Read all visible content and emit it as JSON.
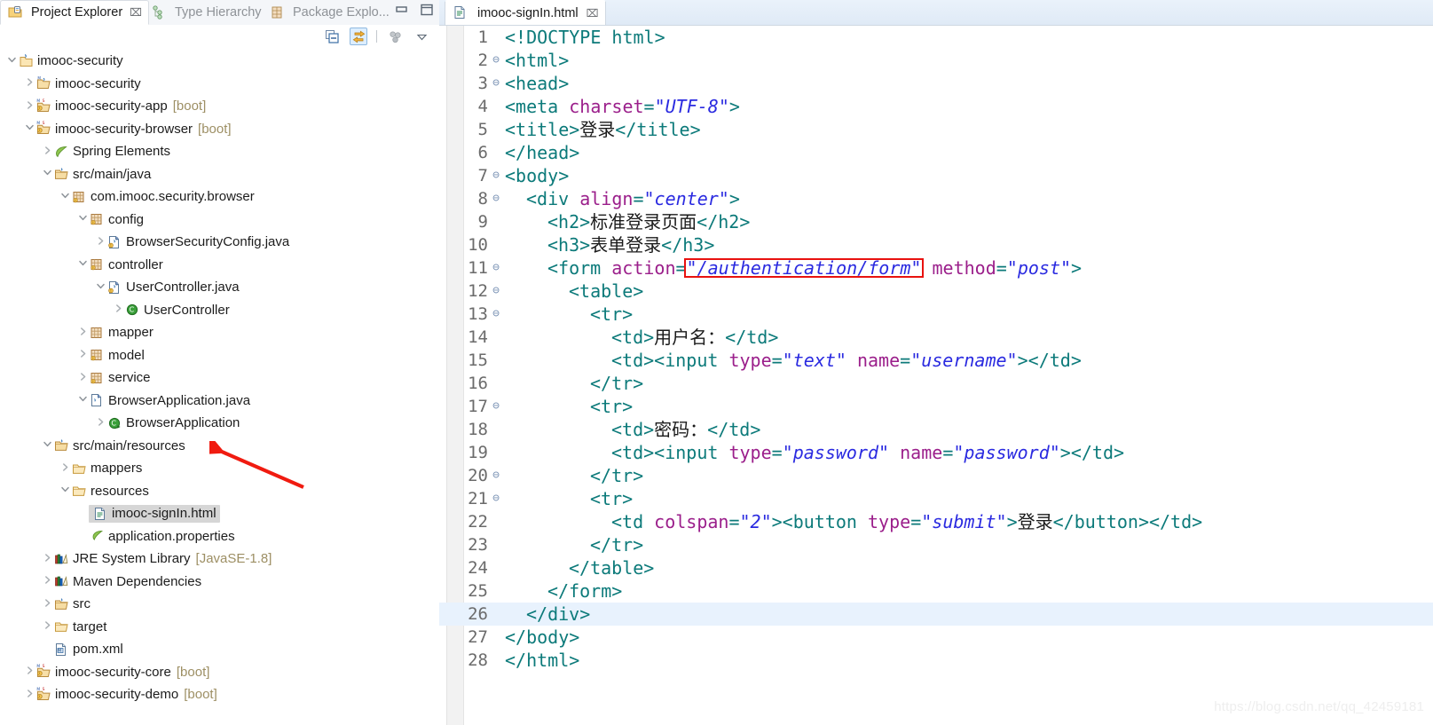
{
  "window": {
    "minimize_icon": "minimize-icon",
    "maximize_icon": "maximize-icon"
  },
  "left_view": {
    "tabs": [
      {
        "label": "Project Explorer",
        "icon": "project-explorer-icon",
        "active": true,
        "close": "⌧"
      },
      {
        "label": "Type Hierarchy",
        "icon": "type-hierarchy-icon",
        "active": false
      },
      {
        "label": "Package Explo...",
        "icon": "package-explorer-icon",
        "active": false
      }
    ],
    "toolbar": [
      {
        "name": "collapse-all-button",
        "title": "Collapse All"
      },
      {
        "name": "link-with-editor-button",
        "title": "Link with Editor",
        "toggled": true
      },
      {
        "name": "view-menu-dots-button",
        "title": "View Menu"
      },
      {
        "name": "view-menu-chevron-button",
        "title": "View Menu"
      }
    ],
    "tree": [
      {
        "indent": 0,
        "twist": "v",
        "icon": "java-project-icon",
        "label": "imooc-security",
        "suffix": ""
      },
      {
        "indent": 1,
        "twist": ">",
        "icon": "maven-module-icon",
        "label": "imooc-security",
        "suffix": ""
      },
      {
        "indent": 1,
        "twist": ">",
        "icon": "maven-boot-module-icon",
        "label": "imooc-security-app",
        "suffix": "[boot]"
      },
      {
        "indent": 1,
        "twist": "v",
        "icon": "maven-boot-module-icon",
        "label": "imooc-security-browser",
        "suffix": "[boot]"
      },
      {
        "indent": 2,
        "twist": ">",
        "icon": "spring-leaf-icon",
        "label": "Spring Elements",
        "suffix": ""
      },
      {
        "indent": 2,
        "twist": "v",
        "icon": "source-folder-icon",
        "label": "src/main/java",
        "suffix": ""
      },
      {
        "indent": 3,
        "twist": "v",
        "icon": "package-icon",
        "label": "com.imooc.security.browser",
        "suffix": ""
      },
      {
        "indent": 4,
        "twist": "v",
        "icon": "package-icon",
        "label": "config",
        "suffix": ""
      },
      {
        "indent": 5,
        "twist": ">",
        "icon": "java-file-icon",
        "label": "BrowserSecurityConfig.java",
        "suffix": ""
      },
      {
        "indent": 4,
        "twist": "v",
        "icon": "package-icon",
        "label": "controller",
        "suffix": ""
      },
      {
        "indent": 5,
        "twist": "v",
        "icon": "java-file-icon",
        "label": "UserController.java",
        "suffix": ""
      },
      {
        "indent": 6,
        "twist": ">",
        "icon": "java-class-icon",
        "label": "UserController",
        "suffix": ""
      },
      {
        "indent": 4,
        "twist": ">",
        "icon": "package-plain-icon",
        "label": "mapper",
        "suffix": ""
      },
      {
        "indent": 4,
        "twist": ">",
        "icon": "package-icon",
        "label": "model",
        "suffix": ""
      },
      {
        "indent": 4,
        "twist": ">",
        "icon": "package-icon",
        "label": "service",
        "suffix": ""
      },
      {
        "indent": 4,
        "twist": "v",
        "icon": "java-file-plain-icon",
        "label": "BrowserApplication.java",
        "suffix": ""
      },
      {
        "indent": 5,
        "twist": ">",
        "icon": "java-runnable-class-icon",
        "label": "BrowserApplication",
        "suffix": ""
      },
      {
        "indent": 2,
        "twist": "v",
        "icon": "source-folder-icon",
        "label": "src/main/resources",
        "suffix": ""
      },
      {
        "indent": 3,
        "twist": ">",
        "icon": "folder-icon",
        "label": "mappers",
        "suffix": ""
      },
      {
        "indent": 3,
        "twist": "v",
        "icon": "folder-icon",
        "label": "resources",
        "suffix": ""
      },
      {
        "indent": 4,
        "twist": "",
        "icon": "html-file-icon",
        "label": "imooc-signIn.html",
        "suffix": "",
        "selected": true
      },
      {
        "indent": 4,
        "twist": "",
        "icon": "properties-file-icon",
        "label": "application.properties",
        "suffix": ""
      },
      {
        "indent": 2,
        "twist": ">",
        "icon": "library-icon",
        "label": "JRE System Library",
        "suffix": "[JavaSE-1.8]"
      },
      {
        "indent": 2,
        "twist": ">",
        "icon": "library-icon",
        "label": "Maven Dependencies",
        "suffix": ""
      },
      {
        "indent": 2,
        "twist": ">",
        "icon": "source-folder-icon",
        "label": "src",
        "suffix": ""
      },
      {
        "indent": 2,
        "twist": ">",
        "icon": "folder-icon",
        "label": "target",
        "suffix": ""
      },
      {
        "indent": 2,
        "twist": "",
        "icon": "maven-pom-icon",
        "label": "pom.xml",
        "suffix": ""
      },
      {
        "indent": 1,
        "twist": ">",
        "icon": "maven-boot-module-icon",
        "label": "imooc-security-core",
        "suffix": "[boot]"
      },
      {
        "indent": 1,
        "twist": ">",
        "icon": "maven-boot-module-icon",
        "label": "imooc-security-demo",
        "suffix": "[boot]"
      }
    ]
  },
  "editor": {
    "tab": {
      "label": "imooc-signIn.html",
      "icon": "html-file-icon",
      "close": "⌧"
    },
    "highlighted_line": 26,
    "annotation": {
      "type": "red-box",
      "target_text": "\"/authentication/form\""
    },
    "lines": [
      {
        "n": 1,
        "fold": "",
        "indent": 0,
        "tokens": [
          {
            "t": "tag",
            "v": "<!DOCTYPE html>"
          }
        ]
      },
      {
        "n": 2,
        "fold": "⊖",
        "indent": 0,
        "tokens": [
          {
            "t": "tag",
            "v": "<html>"
          }
        ]
      },
      {
        "n": 3,
        "fold": "⊖",
        "indent": 0,
        "tokens": [
          {
            "t": "tag",
            "v": "<head>"
          }
        ]
      },
      {
        "n": 4,
        "fold": "",
        "indent": 0,
        "tokens": [
          {
            "t": "tag",
            "v": "<meta "
          },
          {
            "t": "attr",
            "v": "charset"
          },
          {
            "t": "tag",
            "v": "="
          },
          {
            "t": "val",
            "v": "\"UTF-8\""
          },
          {
            "t": "tag",
            "v": ">"
          }
        ]
      },
      {
        "n": 5,
        "fold": "",
        "indent": 0,
        "tokens": [
          {
            "t": "tag",
            "v": "<title>"
          },
          {
            "t": "txt",
            "v": "登录"
          },
          {
            "t": "tag",
            "v": "</title>"
          }
        ]
      },
      {
        "n": 6,
        "fold": "",
        "indent": 0,
        "tokens": [
          {
            "t": "tag",
            "v": "</head>"
          }
        ]
      },
      {
        "n": 7,
        "fold": "⊖",
        "indent": 0,
        "tokens": [
          {
            "t": "tag",
            "v": "<body>"
          }
        ]
      },
      {
        "n": 8,
        "fold": "⊖",
        "indent": 1,
        "tokens": [
          {
            "t": "tag",
            "v": "<div "
          },
          {
            "t": "attr",
            "v": "align"
          },
          {
            "t": "tag",
            "v": "="
          },
          {
            "t": "val",
            "v": "\"center\""
          },
          {
            "t": "tag",
            "v": ">"
          }
        ]
      },
      {
        "n": 9,
        "fold": "",
        "indent": 2,
        "tokens": [
          {
            "t": "tag",
            "v": "<h2>"
          },
          {
            "t": "txt",
            "v": "标准登录页面"
          },
          {
            "t": "tag",
            "v": "</h2>"
          }
        ]
      },
      {
        "n": 10,
        "fold": "",
        "indent": 2,
        "tokens": [
          {
            "t": "tag",
            "v": "<h3>"
          },
          {
            "t": "txt",
            "v": "表单登录"
          },
          {
            "t": "tag",
            "v": "</h3>"
          }
        ]
      },
      {
        "n": 11,
        "fold": "⊖",
        "indent": 2,
        "tokens": [
          {
            "t": "tag",
            "v": "<form "
          },
          {
            "t": "attr",
            "v": "action"
          },
          {
            "t": "tag",
            "v": "="
          },
          {
            "t": "val",
            "v": "\"/authentication/form\"",
            "box": true
          },
          {
            "t": "tag",
            "v": " "
          },
          {
            "t": "attr",
            "v": "method"
          },
          {
            "t": "tag",
            "v": "="
          },
          {
            "t": "val",
            "v": "\"post\""
          },
          {
            "t": "tag",
            "v": ">"
          }
        ]
      },
      {
        "n": 12,
        "fold": "⊖",
        "indent": 3,
        "tokens": [
          {
            "t": "tag",
            "v": "<table>"
          }
        ]
      },
      {
        "n": 13,
        "fold": "⊖",
        "indent": 4,
        "tokens": [
          {
            "t": "tag",
            "v": "<tr>"
          }
        ]
      },
      {
        "n": 14,
        "fold": "",
        "indent": 5,
        "tokens": [
          {
            "t": "tag",
            "v": "<td>"
          },
          {
            "t": "txt",
            "v": "用户名："
          },
          {
            "t": "tag",
            "v": "</td>"
          }
        ]
      },
      {
        "n": 15,
        "fold": "",
        "indent": 5,
        "tokens": [
          {
            "t": "tag",
            "v": "<td><input "
          },
          {
            "t": "attr",
            "v": "type"
          },
          {
            "t": "tag",
            "v": "="
          },
          {
            "t": "val",
            "v": "\"text\""
          },
          {
            "t": "tag",
            "v": " "
          },
          {
            "t": "attr",
            "v": "name"
          },
          {
            "t": "tag",
            "v": "="
          },
          {
            "t": "val",
            "v": "\"username\""
          },
          {
            "t": "tag",
            "v": "></td>"
          }
        ]
      },
      {
        "n": 16,
        "fold": "",
        "indent": 4,
        "tokens": [
          {
            "t": "tag",
            "v": "</tr>"
          }
        ]
      },
      {
        "n": 17,
        "fold": "⊖",
        "indent": 4,
        "tokens": [
          {
            "t": "tag",
            "v": "<tr>"
          }
        ]
      },
      {
        "n": 18,
        "fold": "",
        "indent": 5,
        "tokens": [
          {
            "t": "tag",
            "v": "<td>"
          },
          {
            "t": "txt",
            "v": "密码："
          },
          {
            "t": "tag",
            "v": "</td>"
          }
        ]
      },
      {
        "n": 19,
        "fold": "",
        "indent": 5,
        "tokens": [
          {
            "t": "tag",
            "v": "<td><input "
          },
          {
            "t": "attr",
            "v": "type"
          },
          {
            "t": "tag",
            "v": "="
          },
          {
            "t": "val",
            "v": "\"password\""
          },
          {
            "t": "tag",
            "v": " "
          },
          {
            "t": "attr",
            "v": "name"
          },
          {
            "t": "tag",
            "v": "="
          },
          {
            "t": "val",
            "v": "\"password\""
          },
          {
            "t": "tag",
            "v": "></td>"
          }
        ]
      },
      {
        "n": 20,
        "fold": "⊖",
        "indent": 4,
        "tokens": [
          {
            "t": "tag",
            "v": "</tr>"
          }
        ]
      },
      {
        "n": 21,
        "fold": "⊖",
        "indent": 4,
        "tokens": [
          {
            "t": "tag",
            "v": "<tr>"
          }
        ]
      },
      {
        "n": 22,
        "fold": "",
        "indent": 5,
        "tokens": [
          {
            "t": "tag",
            "v": "<td "
          },
          {
            "t": "attr",
            "v": "colspan"
          },
          {
            "t": "tag",
            "v": "="
          },
          {
            "t": "val",
            "v": "\"2\""
          },
          {
            "t": "tag",
            "v": "><button "
          },
          {
            "t": "attr",
            "v": "type"
          },
          {
            "t": "tag",
            "v": "="
          },
          {
            "t": "val",
            "v": "\"submit\""
          },
          {
            "t": "tag",
            "v": ">"
          },
          {
            "t": "txt",
            "v": "登录"
          },
          {
            "t": "tag",
            "v": "</button></td>"
          }
        ]
      },
      {
        "n": 23,
        "fold": "",
        "indent": 4,
        "tokens": [
          {
            "t": "tag",
            "v": "</tr>"
          }
        ]
      },
      {
        "n": 24,
        "fold": "",
        "indent": 3,
        "tokens": [
          {
            "t": "tag",
            "v": "</table>"
          }
        ]
      },
      {
        "n": 25,
        "fold": "",
        "indent": 2,
        "tokens": [
          {
            "t": "tag",
            "v": "</form>"
          }
        ]
      },
      {
        "n": 26,
        "fold": "",
        "indent": 1,
        "tokens": [
          {
            "t": "tag",
            "v": "</div>"
          }
        ],
        "hl": true
      },
      {
        "n": 27,
        "fold": "",
        "indent": 0,
        "tokens": [
          {
            "t": "tag",
            "v": "</body>"
          }
        ]
      },
      {
        "n": 28,
        "fold": "",
        "indent": 0,
        "tokens": [
          {
            "t": "tag",
            "v": "</html>"
          }
        ]
      }
    ]
  },
  "watermark": "https://blog.csdn.net/qq_42459181",
  "colors": {
    "tag": "#0c7a7a",
    "attribute": "#9b1f8b",
    "value": "#2a2ae0",
    "annotation_red": "#e8120f",
    "selection_gray": "#d6d6d6",
    "line_highlight": "#e8f2fd",
    "suffix_tan": "#9d8f64"
  }
}
